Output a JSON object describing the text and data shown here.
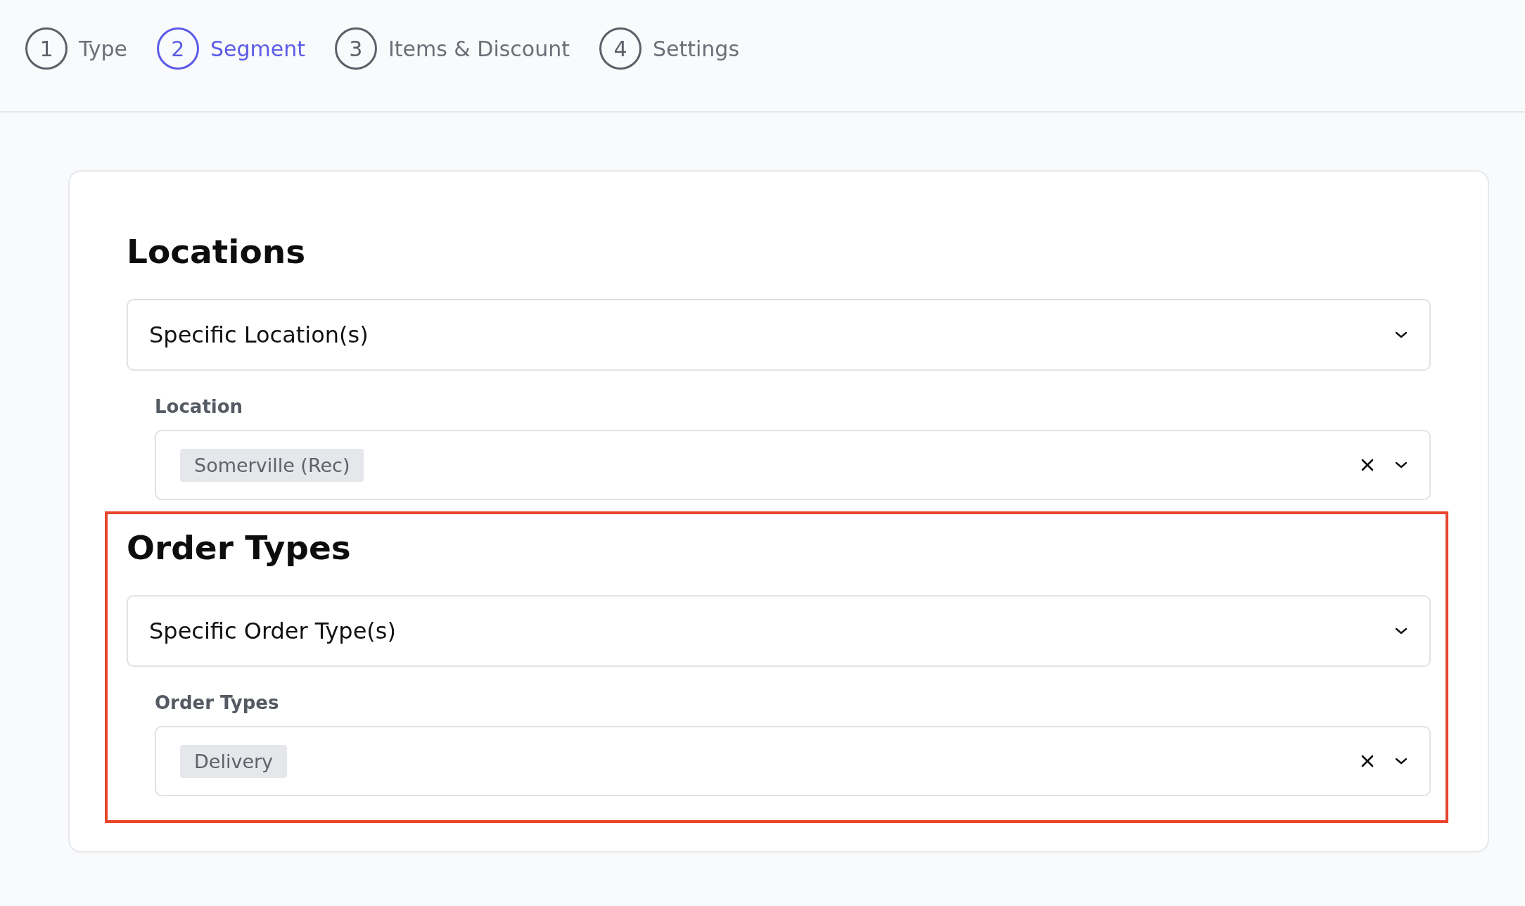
{
  "steps": [
    {
      "number": "1",
      "label": "Type",
      "selected": false
    },
    {
      "number": "2",
      "label": "Segment",
      "selected": true
    },
    {
      "number": "3",
      "label": "Items & Discount",
      "selected": false
    },
    {
      "number": "4",
      "label": "Settings",
      "selected": false
    }
  ],
  "sections": [
    {
      "title": "Locations",
      "select": "Specific Location(s)",
      "field_label": "Location",
      "chips": [
        "Somerville (Rec)"
      ],
      "highlighted": false
    },
    {
      "title": "Order Types",
      "select": "Specific Order Type(s)",
      "field_label": "Order Types",
      "chips": [
        "Delivery"
      ],
      "highlighted": true
    }
  ]
}
